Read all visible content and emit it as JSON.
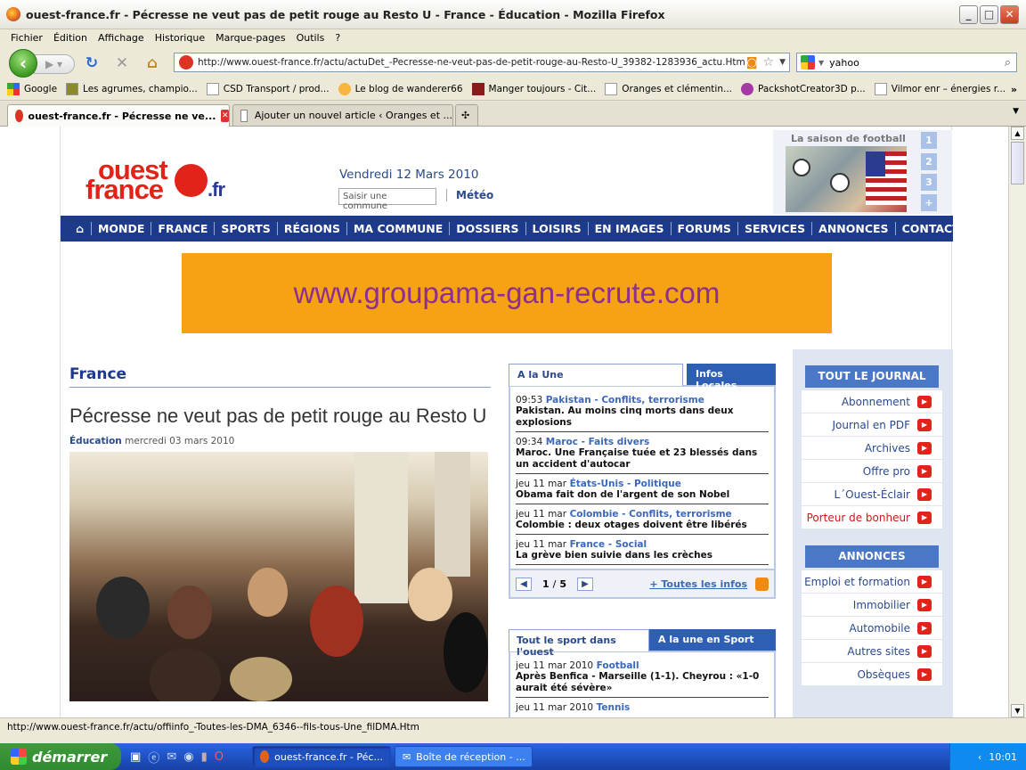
{
  "window": {
    "title": "ouest-france.fr - Pécresse ne veut pas de petit rouge au Resto U - France - Éducation - Mozilla Firefox"
  },
  "menu": [
    "Fichier",
    "Édition",
    "Affichage",
    "Historique",
    "Marque-pages",
    "Outils",
    "?"
  ],
  "url": "http://www.ouest-france.fr/actu/actuDet_-Pecresse-ne-veut-pas-de-petit-rouge-au-Resto-U_39382-1283936_actu.Htm",
  "search": {
    "value": "yahoo"
  },
  "bookmarks": [
    "Google",
    "Les agrumes, champio...",
    "CSD Transport / prod...",
    "Le blog de wanderer66",
    "Manger toujours - Cit...",
    "Oranges et clémentin...",
    "PackshotCreator3D p...",
    "Vilmor enr – énergies r..."
  ],
  "tabs": [
    "ouest-france.fr - Pécresse ne ve...",
    "Ajouter un nouvel article ‹ Oranges et ..."
  ],
  "page": {
    "logo_line1": "ouest",
    "logo_line2": "france",
    "logo_fr": ".fr",
    "date": "Vendredi 12 Mars 2010",
    "commune_placeholder": "Saisir une commune",
    "meteo": "Météo",
    "promo_title": "La saison de football",
    "promo_pages": [
      "1",
      "2",
      "3",
      "+"
    ],
    "nav": [
      "MONDE",
      "FRANCE",
      "SPORTS",
      "RÉGIONS",
      "MA COMMUNE",
      "DOSSIERS",
      "LOISIRS",
      "EN IMAGES",
      "FORUMS",
      "SERVICES",
      "ANNONCES",
      "CONTACT"
    ],
    "banner": "www.groupama-gan-recrute.com",
    "section": "France",
    "headline": "Pécresse ne veut pas de petit rouge au Resto U",
    "meta_cat": "Éducation",
    "meta_date": "mercredi 03 mars 2010",
    "alaune": {
      "tab1": "A la Une",
      "tab2": "Infos Locales",
      "items": [
        {
          "time": "09:53",
          "cat": "Pakistan - Conflits, terrorisme",
          "text": "Pakistan. Au moins cinq morts dans deux explosions"
        },
        {
          "time": "09:34",
          "cat": "Maroc - Faits divers",
          "text": "Maroc. Une Française tuée et 23 blessés dans un accident d'autocar"
        },
        {
          "time": "jeu 11 mar",
          "cat": "États-Unis - Politique",
          "text": "Obama fait don de l'argent de son Nobel"
        },
        {
          "time": "jeu 11 mar",
          "cat": "Colombie - Conflits, terrorisme",
          "text": "Colombie : deux otages doivent être libérés"
        },
        {
          "time": "jeu 11 mar",
          "cat": "France - Social",
          "text": "La grève bien suivie dans les crèches"
        }
      ],
      "page": "1",
      "pages": "5",
      "all_link": "+ Toutes les infos"
    },
    "sport": {
      "tab1": "Tout le sport dans l'ouest",
      "tab2": "A la une en Sport",
      "items": [
        {
          "time": "jeu 11 mar 2010",
          "cat": "Football",
          "text": "Après Benfica - Marseille (1-1). Cheyrou : «1-0 aurait été sévère»"
        },
        {
          "time": "jeu 11 mar 2010",
          "cat": "Tennis",
          "text": ""
        }
      ]
    },
    "journal": {
      "title": "TOUT LE JOURNAL",
      "items": [
        "Abonnement",
        "Journal en PDF",
        "Archives",
        "Offre pro",
        "L´Ouest-Éclair",
        "Porteur de bonheur"
      ]
    },
    "annonces": {
      "title": "ANNONCES",
      "items": [
        "Emploi et formation",
        "Immobilier",
        "Automobile",
        "Autres sites",
        "Obsèques"
      ]
    }
  },
  "status": "http://www.ouest-france.fr/actu/offiinfo_-Toutes-les-DMA_6346--fils-tous-Une_filDMA.Htm",
  "taskbar": {
    "start": "démarrer",
    "tasks": [
      "ouest-france.fr - Péc...",
      "Boîte de réception - ..."
    ],
    "clock": "10:01"
  }
}
